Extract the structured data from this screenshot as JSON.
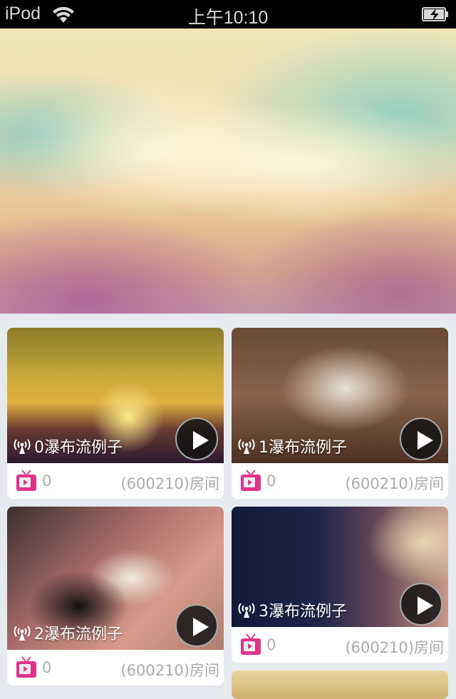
{
  "status_bar": {
    "carrier": "iPod",
    "time": "上午10:10"
  },
  "cards": [
    {
      "title": "0瀑布流例子",
      "count": "0",
      "room": "(600210)房间"
    },
    {
      "title": "1瀑布流例子",
      "count": "0",
      "room": "(600210)房间"
    },
    {
      "title": "2瀑布流例子",
      "count": "0",
      "room": "(600210)房间"
    },
    {
      "title": "3瀑布流例子",
      "count": "0",
      "room": "(600210)房间"
    }
  ],
  "colors": {
    "background": "#e6eaee",
    "tv_icon": "#e0338a"
  }
}
